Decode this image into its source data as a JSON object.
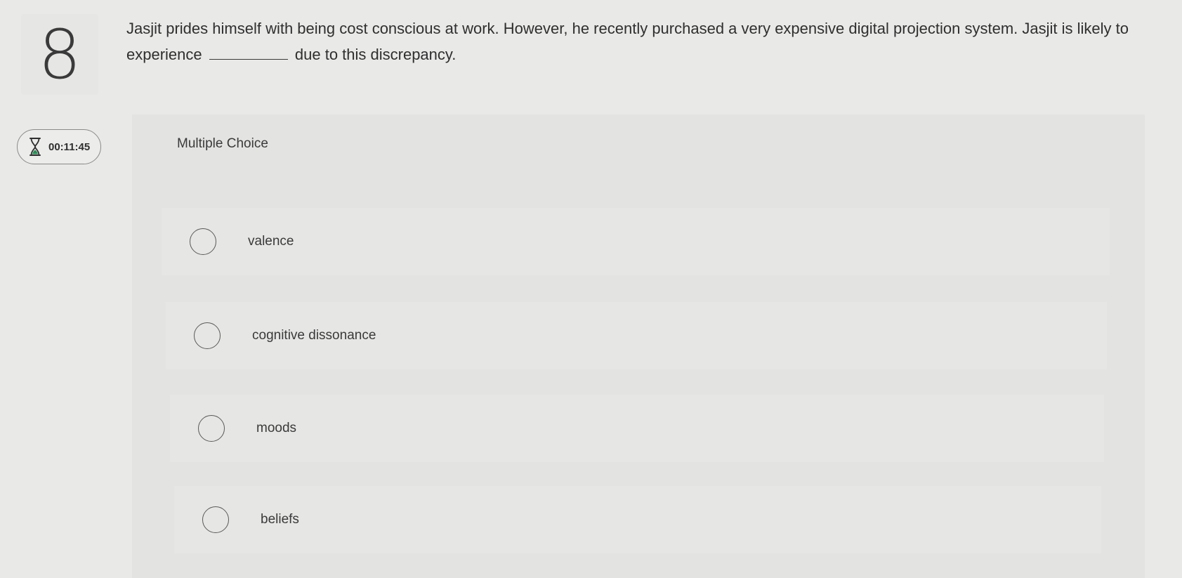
{
  "question": {
    "number": "8",
    "text_before": "Jasjit prides himself with being cost conscious at work. However, he recently purchased a very expensive digital projection system. Jasjit is likely to experience",
    "text_after": "due to this discrepancy."
  },
  "timer": {
    "icon": "hourglass-icon",
    "time": "00:11:45",
    "accent_color": "#2e8b57"
  },
  "answer_section": {
    "type_label": "Multiple Choice",
    "options": [
      {
        "label": "valence"
      },
      {
        "label": "cognitive dissonance"
      },
      {
        "label": "moods"
      },
      {
        "label": "beliefs"
      }
    ]
  }
}
